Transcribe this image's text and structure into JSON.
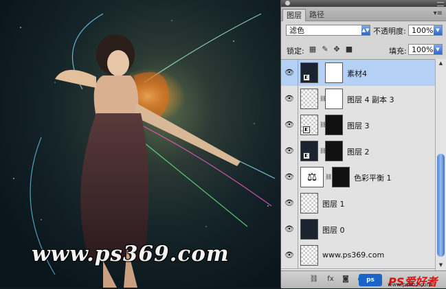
{
  "canvas": {
    "watermark_text": "www.ps369.com"
  },
  "panel": {
    "tabs": [
      {
        "label": "图层"
      },
      {
        "label": "路径"
      }
    ],
    "menu_icon": "panel-menu-icon",
    "blend_mode": "滤色",
    "opacity_label": "不透明度:",
    "opacity_value": "100%",
    "lock_label": "锁定:",
    "fill_label": "填充:",
    "fill_value": "100%",
    "layers": [
      {
        "name": "素材4",
        "selected": true,
        "thumb": "dark",
        "mask": "white",
        "smart": true
      },
      {
        "name": "图层 4 副本 3",
        "selected": false,
        "thumb": "transparent",
        "mask": "white",
        "smart": false
      },
      {
        "name": "图层 3",
        "selected": false,
        "thumb": "transparent",
        "mask": "black",
        "smart": true
      },
      {
        "name": "图层 2",
        "selected": false,
        "thumb": "dark",
        "mask": "black",
        "smart": true
      },
      {
        "name": "色彩平衡 1",
        "selected": false,
        "thumb": "balance",
        "mask": "black",
        "smart": false
      },
      {
        "name": "图层 1",
        "selected": false,
        "thumb": "transparent",
        "mask": null,
        "smart": false
      },
      {
        "name": "图层 0",
        "selected": false,
        "thumb": "dark",
        "mask": null,
        "smart": false
      },
      {
        "name": "www.ps369.com",
        "selected": false,
        "thumb": "transparent",
        "mask": null,
        "smart": false
      }
    ],
    "watermark_logo": {
      "box_text": "ps",
      "brand_text": "PS爱好者",
      "site_text": "www.psahz.com"
    }
  }
}
